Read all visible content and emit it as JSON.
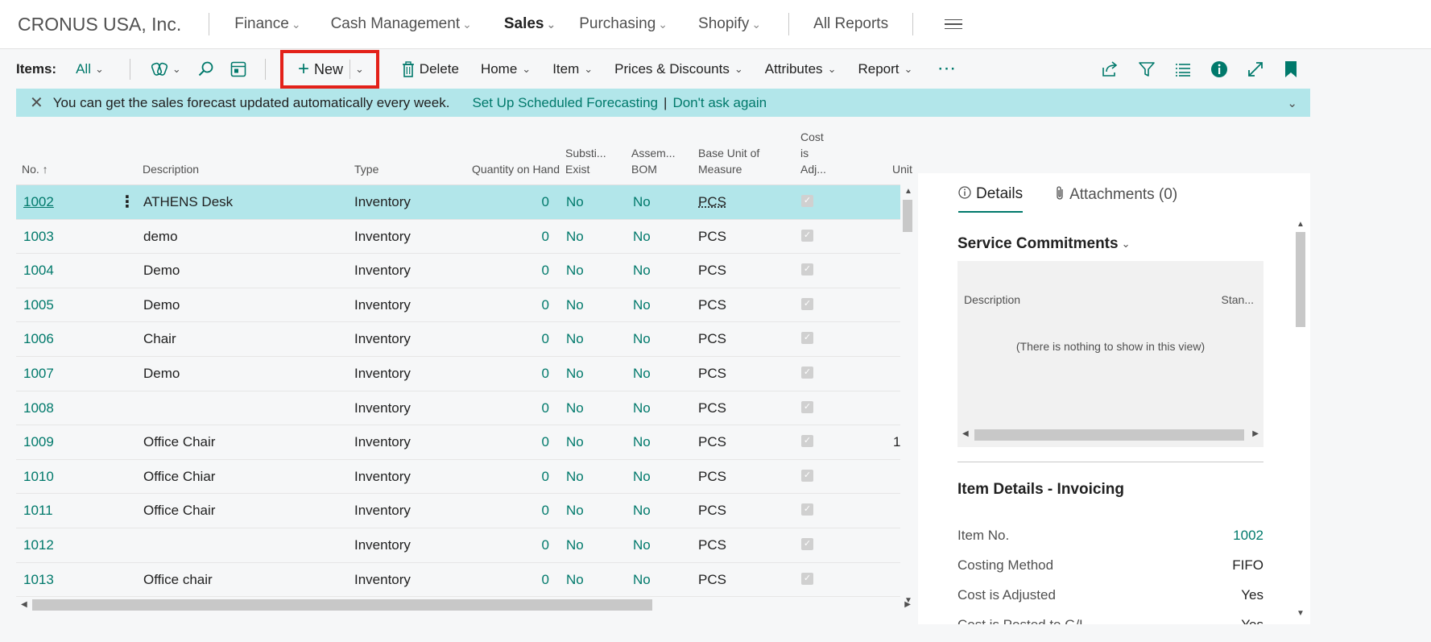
{
  "nav": {
    "company": "CRONUS USA, Inc.",
    "items": [
      {
        "label": "Finance",
        "has_menu": true
      },
      {
        "label": "Cash Management",
        "has_menu": true
      },
      {
        "label": "Sales",
        "has_menu": true,
        "active": true
      },
      {
        "label": "Purchasing",
        "has_menu": true
      },
      {
        "label": "Shopify",
        "has_menu": true
      }
    ],
    "all_reports": "All Reports",
    "menu_icon": "hamburger-icon"
  },
  "actionbar": {
    "label": "Items:",
    "filter_value": "All",
    "new_label": "New",
    "delete_label": "Delete",
    "menus": [
      "Home",
      "Item",
      "Prices & Discounts",
      "Attributes",
      "Report"
    ],
    "more": "···",
    "icons": [
      "copilot-icon",
      "search-icon",
      "edit-list-icon",
      "share-icon",
      "filter-icon",
      "list-view-icon",
      "info-icon",
      "expand-icon",
      "bookmark-icon"
    ]
  },
  "banner": {
    "message": "You can get the sales forecast updated automatically every week.",
    "link1": "Set Up Scheduled Forecasting",
    "separator": "|",
    "link2": "Don't ask again",
    "color": "#b2e6ea"
  },
  "table": {
    "headers": {
      "no": "No. ↑",
      "description": "Description",
      "type": "Type",
      "qty": "Quantity on Hand",
      "subst_line1": "Substi...",
      "subst_line2": "Exist",
      "bom_line1": "Assem...",
      "bom_line2": "BOM",
      "uom_line1": "Base Unit of",
      "uom_line2": "Measure",
      "cost_line1": "Cost",
      "cost_line2": "is",
      "cost_line3": "Adj...",
      "unit": "Unit"
    },
    "rows": [
      {
        "no": "1002",
        "description": "ATHENS Desk",
        "type": "Inventory",
        "qty": "0",
        "subst": "No",
        "bom": "No",
        "uom": "PCS",
        "cost_adjusted": true,
        "unit": "",
        "selected": true
      },
      {
        "no": "1003",
        "description": "demo",
        "type": "Inventory",
        "qty": "0",
        "subst": "No",
        "bom": "No",
        "uom": "PCS",
        "cost_adjusted": true,
        "unit": ""
      },
      {
        "no": "1004",
        "description": "Demo",
        "type": "Inventory",
        "qty": "0",
        "subst": "No",
        "bom": "No",
        "uom": "PCS",
        "cost_adjusted": true,
        "unit": ""
      },
      {
        "no": "1005",
        "description": "Demo",
        "type": "Inventory",
        "qty": "0",
        "subst": "No",
        "bom": "No",
        "uom": "PCS",
        "cost_adjusted": true,
        "unit": ""
      },
      {
        "no": "1006",
        "description": "Chair",
        "type": "Inventory",
        "qty": "0",
        "subst": "No",
        "bom": "No",
        "uom": "PCS",
        "cost_adjusted": true,
        "unit": ""
      },
      {
        "no": "1007",
        "description": "Demo",
        "type": "Inventory",
        "qty": "0",
        "subst": "No",
        "bom": "No",
        "uom": "PCS",
        "cost_adjusted": true,
        "unit": ""
      },
      {
        "no": "1008",
        "description": "",
        "type": "Inventory",
        "qty": "0",
        "subst": "No",
        "bom": "No",
        "uom": "PCS",
        "cost_adjusted": true,
        "unit": ""
      },
      {
        "no": "1009",
        "description": "Office Chair",
        "type": "Inventory",
        "qty": "0",
        "subst": "No",
        "bom": "No",
        "uom": "PCS",
        "cost_adjusted": true,
        "unit": "1"
      },
      {
        "no": "1010",
        "description": "Office Chiar",
        "type": "Inventory",
        "qty": "0",
        "subst": "No",
        "bom": "No",
        "uom": "PCS",
        "cost_adjusted": true,
        "unit": ""
      },
      {
        "no": "1011",
        "description": "Office Chair",
        "type": "Inventory",
        "qty": "0",
        "subst": "No",
        "bom": "No",
        "uom": "PCS",
        "cost_adjusted": true,
        "unit": ""
      },
      {
        "no": "1012",
        "description": "",
        "type": "Inventory",
        "qty": "0",
        "subst": "No",
        "bom": "No",
        "uom": "PCS",
        "cost_adjusted": true,
        "unit": ""
      },
      {
        "no": "1013",
        "description": "Office chair",
        "type": "Inventory",
        "qty": "0",
        "subst": "No",
        "bom": "No",
        "uom": "PCS",
        "cost_adjusted": true,
        "unit": ""
      }
    ]
  },
  "factbox": {
    "tabs": [
      {
        "label": "Details",
        "icon": "info-circle-icon",
        "active": true
      },
      {
        "label": "Attachments (0)",
        "icon": "paperclip-icon"
      }
    ],
    "service_commitments": {
      "title": "Service Commitments",
      "col1": "Description",
      "col2": "Stan...",
      "empty": "(There is nothing to show in this view)"
    },
    "invoicing": {
      "title": "Item Details - Invoicing",
      "fields": [
        {
          "label": "Item No.",
          "value": "1002",
          "link": true
        },
        {
          "label": "Costing Method",
          "value": "FIFO"
        },
        {
          "label": "Cost is Adjusted",
          "value": "Yes"
        },
        {
          "label": "Cost is Posted to G/L",
          "value": "Yes"
        }
      ]
    }
  },
  "colors": {
    "accent": "#00796b",
    "highlight": "#b2e6ea",
    "red_outline": "#e32119"
  }
}
